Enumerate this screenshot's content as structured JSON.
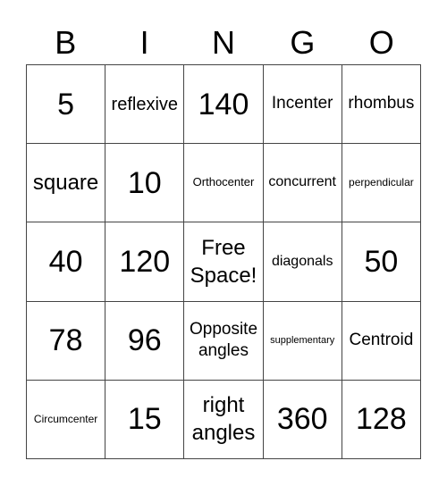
{
  "header": [
    "B",
    "I",
    "N",
    "G",
    "O"
  ],
  "cells": [
    "5",
    "reflexive",
    "140",
    "Incenter",
    "rhombus",
    "square",
    "10",
    "Orthocenter",
    "concurrent",
    "perpendicular",
    "40",
    "120",
    "Free\nSpace!",
    "diagonals",
    "50",
    "78",
    "96",
    "Opposite\nangles",
    "supplementary",
    "Centroid",
    "Circumcenter",
    "15",
    "right\nangles",
    "360",
    "128"
  ]
}
